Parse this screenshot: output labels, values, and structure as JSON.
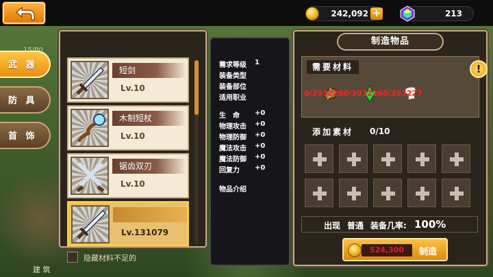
{
  "top_bar": {
    "back_label": "",
    "gold_amount": "242,092",
    "gold_plus": "+",
    "gem_amount": "213"
  },
  "tabs": [
    {
      "label": "武 器",
      "active": true
    },
    {
      "label": "防 具",
      "active": false
    },
    {
      "label": "首 饰",
      "active": false
    }
  ],
  "background_hints": {
    "counter": "15/80",
    "building": "建 筑"
  },
  "item_list": [
    {
      "name": "短剑",
      "level": "Lv.10",
      "icon": "short-sword-icon"
    },
    {
      "name": "木制短杖",
      "level": "Lv.10",
      "icon": "wooden-staff-icon"
    },
    {
      "name": "锯齿双刃",
      "level": "Lv.10",
      "icon": "twin-blades-icon"
    },
    {
      "name": "",
      "level": "Lv.131079",
      "icon": "long-sword-icon",
      "selected": true
    }
  ],
  "hide_checkbox_label": "隐藏材料不足的",
  "details": {
    "required_level_label": "需求等级",
    "required_level_value": "1",
    "equip_type_label": "装备类型",
    "equip_slot_label": "装备部位",
    "job_label": "适用职业",
    "stats": [
      {
        "label": "生　命",
        "value": "+0"
      },
      {
        "label": "物理攻击",
        "value": "+0"
      },
      {
        "label": "物理防御",
        "value": "+0"
      },
      {
        "label": "魔法攻击",
        "value": "+0"
      },
      {
        "label": "魔法防御",
        "value": "+0"
      },
      {
        "label": "回复力",
        "value": "+0"
      }
    ],
    "intro_label": "物品介绍"
  },
  "craft_panel": {
    "title": "制造物品",
    "materials_label": "需要材料",
    "materials_counts": "0/3932260/3932260/393227",
    "materials": [
      "brown-crystal-icon",
      "green-crystal-icon",
      "white-cloth-icon"
    ],
    "add_material_label": "添加素材",
    "add_material_count": "0/10",
    "rate_text": "出现",
    "rate_quality": "普通",
    "rate_label": "装备几率:",
    "rate_value": "100%",
    "cost": "524,300",
    "craft_label": "制造"
  }
}
